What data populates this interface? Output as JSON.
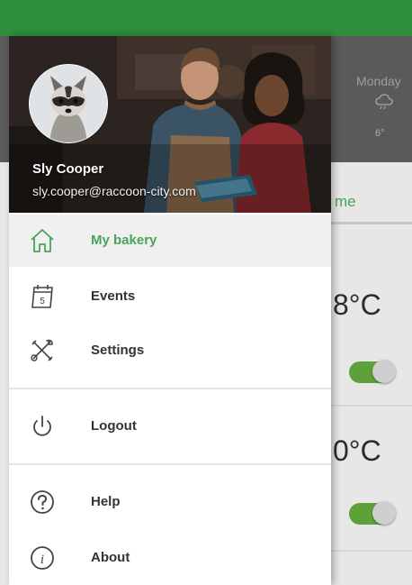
{
  "user": {
    "name": "Sly Cooper",
    "email": "sly.cooper@raccoon-city.com"
  },
  "menu": {
    "items": [
      {
        "label": "My bakery",
        "icon": "home-icon",
        "active": true
      },
      {
        "label": "Events",
        "icon": "calendar-icon",
        "active": false
      },
      {
        "label": "Settings",
        "icon": "tools-icon",
        "active": false
      },
      {
        "label": "Logout",
        "icon": "power-icon",
        "active": false
      },
      {
        "label": "Help",
        "icon": "help-icon",
        "active": false
      },
      {
        "label": "About",
        "icon": "info-icon",
        "active": false
      }
    ]
  },
  "background": {
    "day_label": "Monday",
    "small_temp": "6°",
    "tab_text": "me",
    "temps": [
      "8°C",
      "0°C"
    ],
    "toggles_on": [
      true,
      true
    ]
  },
  "colors": {
    "status_bar": "#2e8f3d",
    "accent": "#4aa35a",
    "toggle_on": "#5ea03a"
  }
}
